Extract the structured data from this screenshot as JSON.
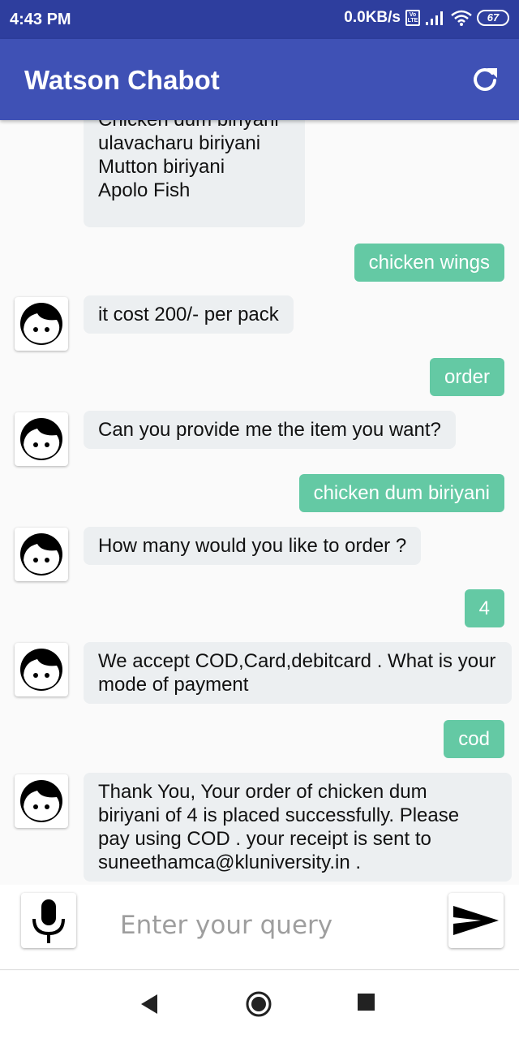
{
  "status_bar": {
    "time": "4:43 PM",
    "network_speed": "0.0KB/s",
    "volte_label": "Vo LTE",
    "battery": "67"
  },
  "app_bar": {
    "title": "Watson Chabot",
    "refresh_icon": "refresh-icon"
  },
  "messages": [
    {
      "sender": "bot",
      "lines": [
        "Chicken dum biriyani",
        "ulavacharu biriyani",
        "Mutton biriyani",
        "Apolo Fish"
      ]
    },
    {
      "sender": "user",
      "text": "chicken wings"
    },
    {
      "sender": "bot",
      "text": "it cost  200/- per pack"
    },
    {
      "sender": "user",
      "text": "order"
    },
    {
      "sender": "bot",
      "text": "Can you provide me the item you want?"
    },
    {
      "sender": "user",
      "text": "chicken dum biriyani"
    },
    {
      "sender": "bot",
      "text": "How many would you like to order ?"
    },
    {
      "sender": "user",
      "text": "4"
    },
    {
      "sender": "bot",
      "lines": [
        "We accept COD,Card,debitcard . What is your",
        "mode of payment"
      ]
    },
    {
      "sender": "user",
      "text": "cod"
    },
    {
      "sender": "bot",
      "lines": [
        "Thank You, Your order of chicken dum",
        "biriyani of 4 is placed successfully. Please",
        "pay using COD . your receipt is sent to",
        "suneethamca@kluniversity.in ."
      ]
    }
  ],
  "input_bar": {
    "placeholder": "Enter your query",
    "mic_icon": "mic-icon",
    "send_icon": "send-icon"
  },
  "nav_bar": {
    "back_icon": "back-triangle-icon",
    "home_icon": "home-circle-icon",
    "recents_icon": "recents-square-icon"
  },
  "colors": {
    "status_bar": "#2e3e9e",
    "app_bar": "#3f51b5",
    "user_bubble": "#64c9a4",
    "bot_bubble": "#eceff1",
    "background": "#fafafa"
  }
}
